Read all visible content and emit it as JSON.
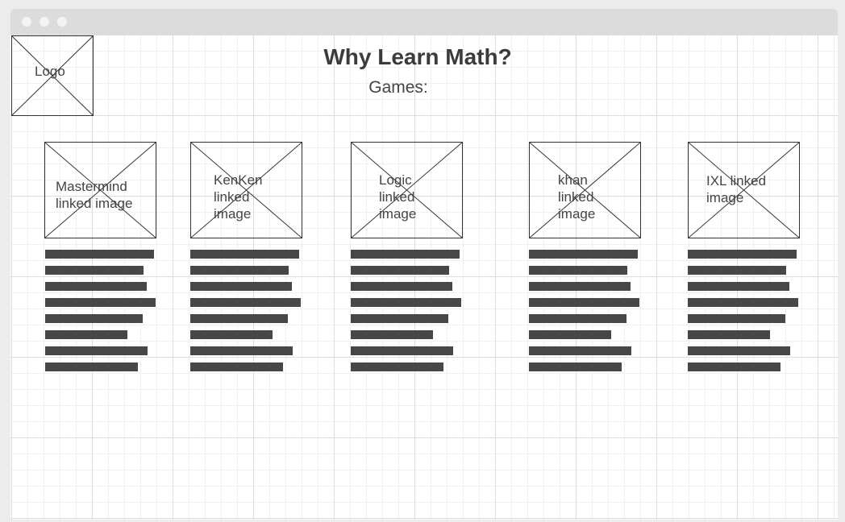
{
  "page": {
    "title": "Why Learn Math?",
    "subtitle": "Games:"
  },
  "logo": {
    "label": "Logo"
  },
  "games": [
    {
      "label": "Mastermind\nlinked image"
    },
    {
      "label": "KenKen\nlinked\nimage"
    },
    {
      "label": "Logic\nlinked\nimage"
    },
    {
      "label": "khan\nlinked\nimage"
    },
    {
      "label": "IXL linked\nimage"
    }
  ],
  "colors": {
    "text_bar": "#474747",
    "placeholder_border": "#333333",
    "grid_major": "#dddddd",
    "grid_minor": "#f0f0f0"
  }
}
